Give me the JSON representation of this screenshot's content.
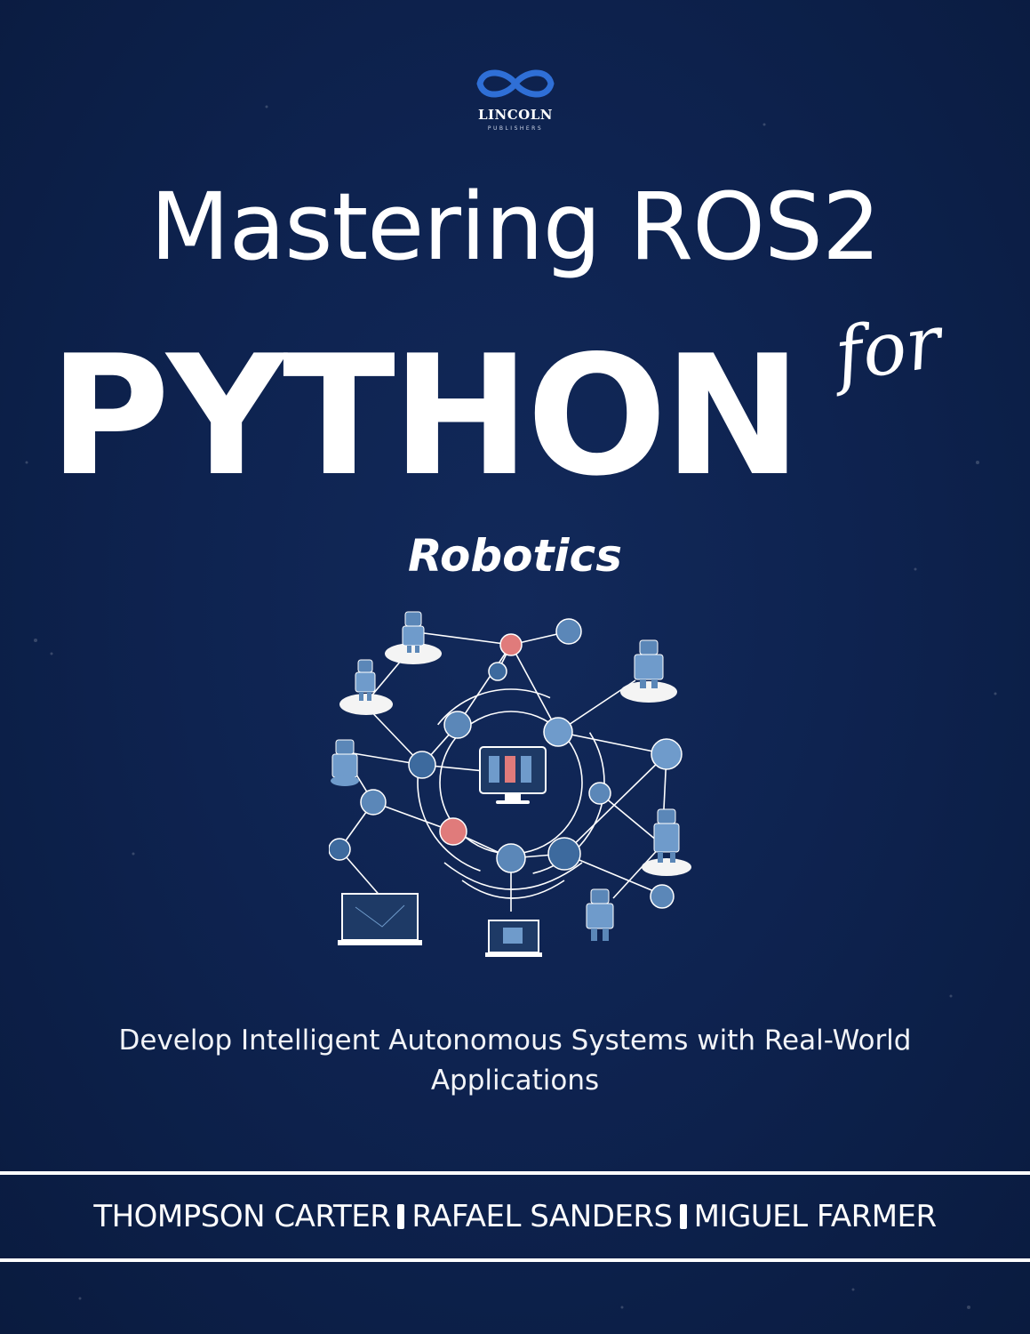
{
  "publisher": {
    "logo_icon": "infinity-icon",
    "name": "LINCOLN",
    "subtitle": "PUBLISHERS"
  },
  "title": {
    "line1": "Mastering ROS2",
    "line2": "PYTHON",
    "connector": "for",
    "subject": "Robotics"
  },
  "illustration": {
    "icon": "robot-network-illustration",
    "colors": {
      "line": "#ffffff",
      "node": "#5b87b8",
      "accent": "#e07b7b",
      "platform": "#f4f4f4"
    }
  },
  "tagline": "Develop Intelligent Autonomous Systems with Real-World Applications",
  "authors": [
    "THOMPSON CARTER",
    "RAFAEL SANDERS",
    "MIGUEL FARMER"
  ],
  "colors": {
    "background": "#0e2350",
    "text": "#ffffff",
    "logo_blue": "#2f6fd6"
  }
}
